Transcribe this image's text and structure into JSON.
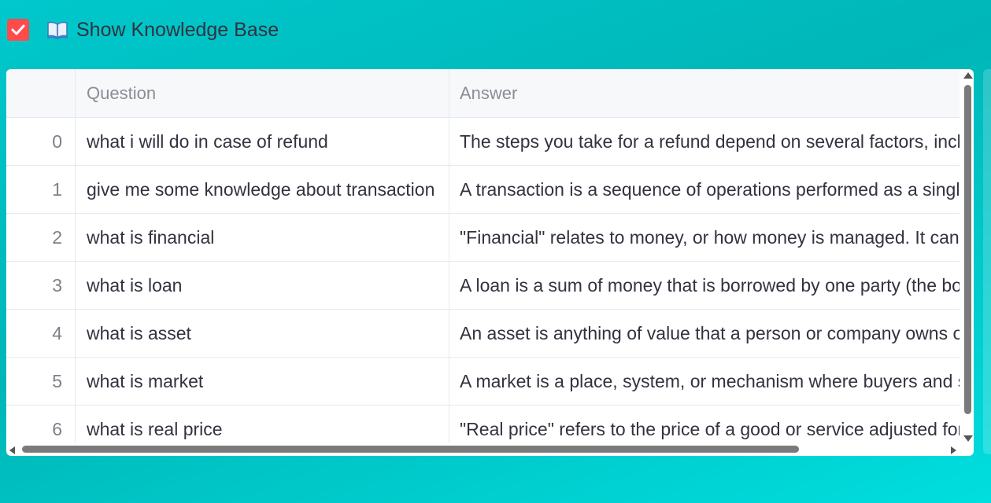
{
  "toggle": {
    "checked": true,
    "icon": "open-book-icon",
    "label": "Show Knowledge Base"
  },
  "colors": {
    "checkbox": "#ff4b4b",
    "background_start": "#00c8cc",
    "background_end": "#00dede"
  },
  "table": {
    "columns": [
      "Question",
      "Answer"
    ],
    "rows": [
      {
        "index": "0",
        "question": "what i will do in case of refund",
        "answer": "The steps you take for a refund depend on several factors, inclu"
      },
      {
        "index": "1",
        "question": "give me some knowledge about transaction",
        "answer": "A transaction is a sequence of operations performed as a single"
      },
      {
        "index": "2",
        "question": "what is financial",
        "answer": "\"Financial\" relates to money, or how money is managed.  It can"
      },
      {
        "index": "3",
        "question": "what is loan",
        "answer": "A loan is a sum of money that is borrowed by one party (the bo"
      },
      {
        "index": "4",
        "question": "what is asset",
        "answer": "An asset is anything of value that a person or company owns or"
      },
      {
        "index": "5",
        "question": "what is market",
        "answer": "A market is a place, system, or mechanism where buyers and se"
      },
      {
        "index": "6",
        "question": "what is real price",
        "answer": "\"Real price\" refers to the price of a good or service adjusted for"
      }
    ]
  }
}
